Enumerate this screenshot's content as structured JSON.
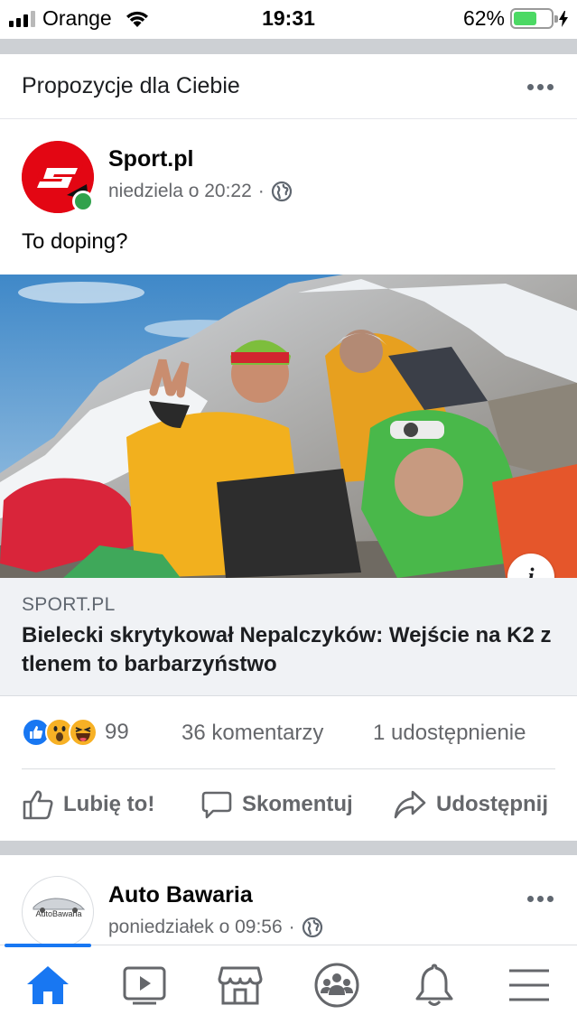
{
  "status_bar": {
    "carrier": "Orange",
    "time": "19:31",
    "battery_percent": "62%",
    "battery_level": 0.62,
    "signal_bars_active": 3
  },
  "feed": {
    "section_title": "Propozycje dla Ciebie",
    "posts": [
      {
        "author": "Sport.pl",
        "timestamp": "niedziela o 20:22",
        "separator": "·",
        "audience_icon": "globe-icon",
        "text": "To doping?",
        "link": {
          "domain": "SPORT.PL",
          "title": "Bielecki skrytykował Nepalczyków: Wejście na K2 z tlenem to barbarzyństwo",
          "info_label": "i"
        },
        "reactions": {
          "icons": [
            "like-icon",
            "wow-icon",
            "haha-icon"
          ],
          "count": "99"
        },
        "comments": "36 komentarzy",
        "shares": "1 udostępnienie",
        "actions": {
          "like": "Lubię to!",
          "comment": "Skomentuj",
          "share": "Udostępnij"
        }
      },
      {
        "author": "Auto Bawaria",
        "timestamp": "poniedziałek o 09:56",
        "separator": "·",
        "audience_icon": "globe-icon",
        "logo_text": "AutoBawaria"
      }
    ]
  },
  "tab_bar": {
    "tabs": [
      "home-icon",
      "video-icon",
      "marketplace-icon",
      "groups-icon",
      "notifications-icon",
      "menu-icon"
    ],
    "active": "home-icon"
  },
  "colors": {
    "accent": "#1877f2",
    "sport_red": "#e30613",
    "online_green": "#31a24c",
    "battery_green": "#4cd964",
    "secondary_text": "#65676b"
  }
}
